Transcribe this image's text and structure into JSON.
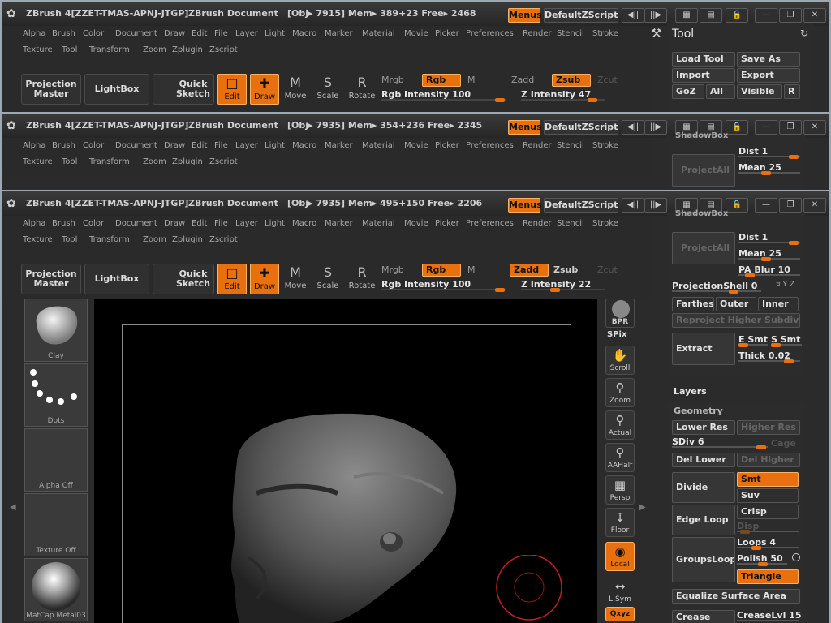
{
  "titlebar_common": {
    "app": "ZBrush 4[ZZET-TMAS-APNJ-JTGP]",
    "doc": "ZBrush Document",
    "menus": "Menus",
    "script": "DefaultZScript"
  },
  "w1": {
    "stats": "[Obj▸ 7915]  Mem▸ 389+23  Free▸ 2468",
    "rgb_int": "Rgb Intensity 100",
    "z_int": "Z  Intensity 47"
  },
  "w2": {
    "stats": "[Obj▸ 7935]  Mem▸ 354+236  Free▸ 2345"
  },
  "w3": {
    "stats": "[Obj▸ 7935]  Mem▸ 495+150  Free▸ 2206",
    "rgb_int": "Rgb Intensity 100",
    "z_int": "Z  Intensity 22"
  },
  "menu_row1": [
    "Alpha",
    "Brush",
    "Color",
    "Document",
    "Draw",
    "Edit",
    "File",
    "Layer",
    "Light",
    "Macro",
    "Marker",
    "Material",
    "Movie",
    "Picker",
    "Preferences",
    "Render",
    "Stencil",
    "Stroke"
  ],
  "menu_row2": [
    "Texture",
    "Tool",
    "Transform",
    "Zoom",
    "Zplugin",
    "Zscript"
  ],
  "toolbar": {
    "projection_master": "Projection Master",
    "lightbox": "LightBox",
    "quick_sketch": "Quick Sketch",
    "edit": "Edit",
    "draw": "Draw",
    "move": "Move",
    "scale": "Scale",
    "rotate": "Rotate",
    "mrgb": "Mrgb",
    "rgb": "Rgb",
    "m": "M",
    "zadd": "Zadd",
    "zsub": "Zsub",
    "zcut": "Zcut"
  },
  "tool_panel": {
    "title": "Tool",
    "load_tool": "Load Tool",
    "save_as": "Save As",
    "import": "Import",
    "export": "Export",
    "goz": "GoZ",
    "all": "All",
    "visible": "Visible",
    "r": "R"
  },
  "w2_panel": {
    "shadowbox": "ShadowBox",
    "project_all": "ProjectAll",
    "dist": "Dist 1",
    "mean": "Mean 25",
    "pa_blur": "PA Blur 10"
  },
  "panel": {
    "shadowbox": "ShadowBox",
    "project_all": "ProjectAll",
    "dist": "Dist 1",
    "mean": "Mean 25",
    "pa_blur": "PA Blur 10",
    "projection_shell": "ProjectionShell 0",
    "xyz": "¤ Y Z",
    "farthest": "Farthest",
    "outer": "Outer",
    "inner": "Inner",
    "reproject": "Reproject Higher Subdiv",
    "extract": "Extract",
    "e_smt": "E Smt",
    "s_smt": "S Smt",
    "thick": "Thick 0.02",
    "layers": "Layers",
    "geometry": "Geometry",
    "lower_res": "Lower Res",
    "higher_res": "Higher Res",
    "sdiv": "SDiv 6",
    "cage": "Cage",
    "del_lower": "Del Lower",
    "del_higher": "Del Higher",
    "divide": "Divide",
    "smt": "Smt",
    "suv": "Suv",
    "edge_loop": "Edge Loop",
    "crisp": "Crisp",
    "disp": "Disp",
    "groups_loops": "GroupsLoops",
    "loops": "Loops 4",
    "polish": "Polish 50",
    "triangle": "Triangle",
    "equalize": "Equalize Surface Area",
    "crease": "Crease",
    "crease_lvl": "CreaseLvl 15"
  },
  "left_shelf": {
    "clay": "Clay",
    "dots": "Dots",
    "alpha": "Alpha  Off",
    "texture": "Texture  Off",
    "matcap": "MatCap  Metal03"
  },
  "view_buttons": {
    "bpr": "BPR",
    "spix": "SPix",
    "scroll": "Scroll",
    "zoom": "Zoom",
    "actual": "Actual",
    "aahalf": "AAHalf",
    "persp": "Persp",
    "floor": "Floor",
    "local": "Local",
    "lsym": "L.Sym",
    "xyz": "Qxyz"
  },
  "colors": {
    "accent": "#e8700f",
    "panel": "#2c2c2c",
    "canvas": "#000000"
  }
}
